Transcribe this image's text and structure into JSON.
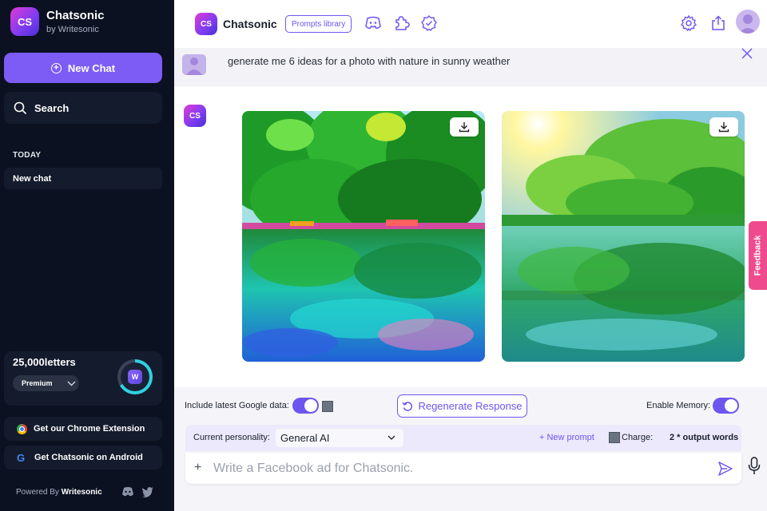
{
  "sidebar": {
    "logo_text": "CS",
    "brand_name": "Chatsonic",
    "brand_sub": "by Writesonic",
    "new_chat_label": "New Chat",
    "search_label": "Search",
    "section_today": "TODAY",
    "chats": [
      {
        "label": "New chat"
      }
    ],
    "credits": {
      "amount": "25,000letters",
      "plan": "Premium",
      "ring_logo": "W",
      "ring_fill_fraction": 0.67
    },
    "chrome_ext_label": "Get our Chrome Extension",
    "android_label": "Get Chatsonic on Android",
    "powered_prefix": "Powered By",
    "powered_brand": "Writesonic"
  },
  "topbar": {
    "logo_text": "CS",
    "title": "Chatsonic",
    "prompts_library_label": "Prompts library",
    "icons": [
      "discord-icon",
      "puzzle-icon",
      "badge-settings-icon",
      "gear-icon",
      "share-icon",
      "avatar"
    ]
  },
  "conversation": {
    "user_message": "generate me 6 ideas for a photo with nature in sunny weather",
    "bot_logo_text": "CS",
    "images": [
      {
        "name": "generated-image-1",
        "description_hint": "vivid forest lake reflection"
      },
      {
        "name": "generated-image-2",
        "description_hint": "sunny lake with trees reflection"
      }
    ]
  },
  "feedback_label": "Feedback",
  "controls": {
    "google_data_label": "Include latest Google data:",
    "google_data_enabled": true,
    "regenerate_label": "Regenerate Response",
    "memory_label": "Enable Memory:",
    "memory_enabled": true,
    "personality_label": "Current personality:",
    "personality_value": "General AI",
    "new_prompt_label": "+ New prompt",
    "charge_label": "Charge:",
    "charge_value": "2 * output words",
    "input_placeholder": "Write a Facebook ad for Chatsonic.",
    "input_value": ""
  },
  "colors": {
    "sidebar_bg": "#0b1120",
    "accent": "#7c5cf5",
    "feedback": "#f04a8e"
  }
}
